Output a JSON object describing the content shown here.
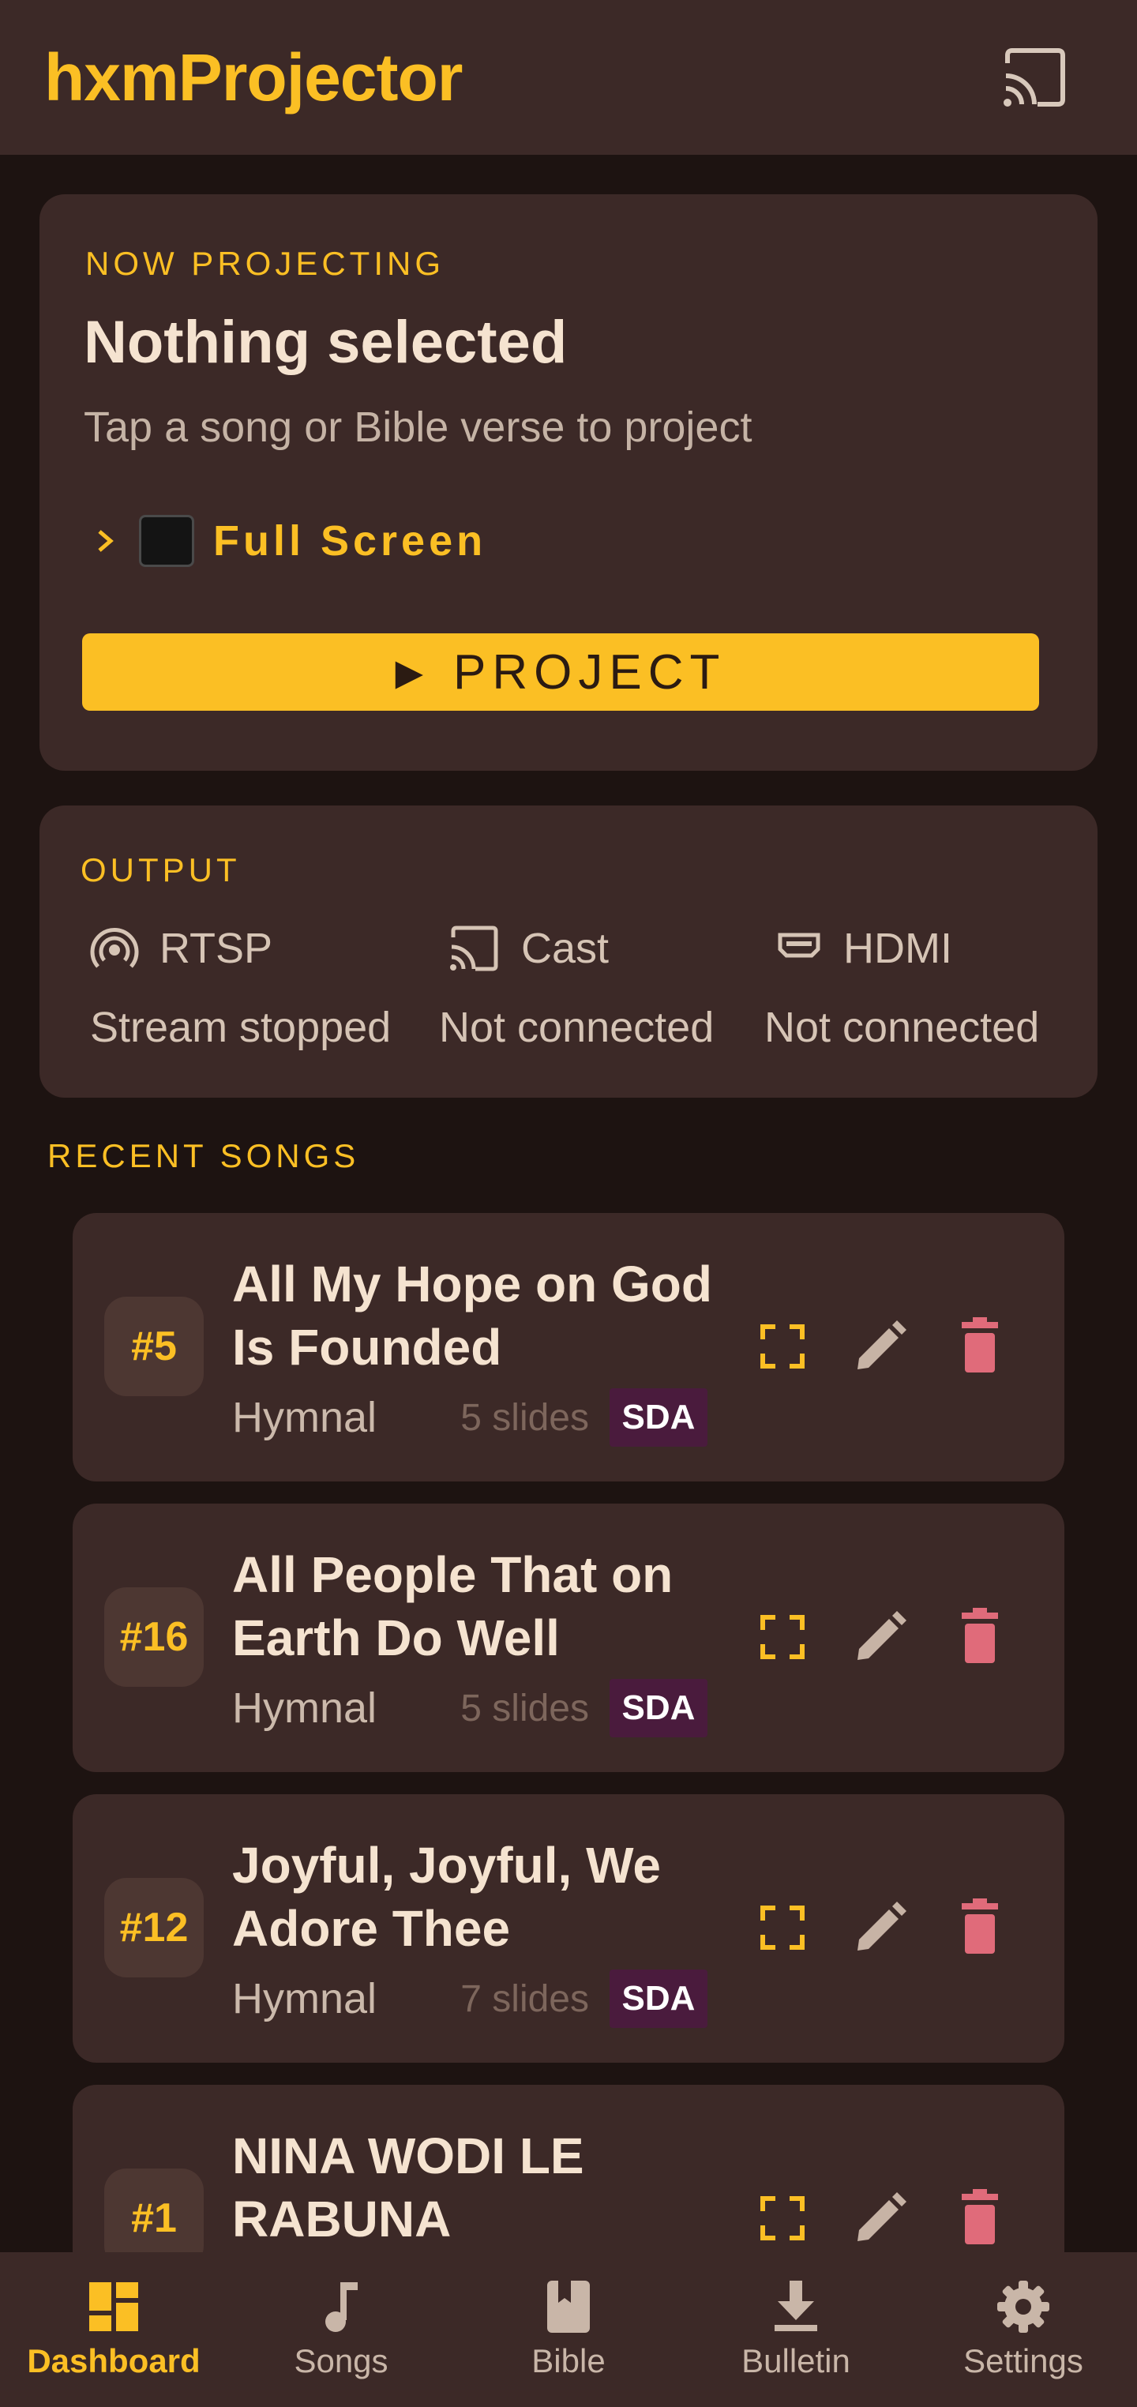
{
  "app": {
    "title": "hxmProjector"
  },
  "now_projecting": {
    "label": "NOW PROJECTING",
    "title": "Nothing selected",
    "subtitle": "Tap a song or Bible verse to project",
    "mode": "Full Screen",
    "button_label": "PROJECT",
    "button_icon": "play-triangle"
  },
  "output": {
    "label": "OUTPUT",
    "items": [
      {
        "icon": "broadcast-icon",
        "name": "RTSP",
        "status": "Stream stopped"
      },
      {
        "icon": "cast-icon",
        "name": "Cast",
        "status": "Not connected"
      },
      {
        "icon": "hdmi-icon",
        "name": "HDMI",
        "status": "Not connected"
      }
    ]
  },
  "recent_songs": {
    "label": "RECENT SONGS",
    "items": [
      {
        "number": "#5",
        "title": "All My Hope on God Is Founded",
        "book": "Hymnal",
        "slides": "5 slides",
        "tag": "SDA"
      },
      {
        "number": "#16",
        "title": "All People That on Earth Do Well",
        "book": "Hymnal",
        "slides": "5 slides",
        "tag": "SDA"
      },
      {
        "number": "#12",
        "title": "Joyful, Joyful, We Adore Thee",
        "book": "Hymnal",
        "slides": "7 slides",
        "tag": "SDA"
      },
      {
        "number": "#1",
        "title": "NINA WODI LE RABUNA",
        "book": "",
        "slides": "",
        "tag": ""
      }
    ]
  },
  "nav": {
    "items": [
      {
        "label": "Dashboard",
        "icon": "dashboard-icon",
        "active": true
      },
      {
        "label": "Songs",
        "icon": "music-note-icon",
        "active": false
      },
      {
        "label": "Bible",
        "icon": "book-icon",
        "active": false
      },
      {
        "label": "Bulletin",
        "icon": "download-icon",
        "active": false
      },
      {
        "label": "Settings",
        "icon": "gear-icon",
        "active": false
      }
    ]
  },
  "colors": {
    "background": "#1d1311",
    "surface": "#3c2927",
    "accent": "#fbbf24",
    "delete": "#e06b7a",
    "tag": "#4a1b3d"
  }
}
